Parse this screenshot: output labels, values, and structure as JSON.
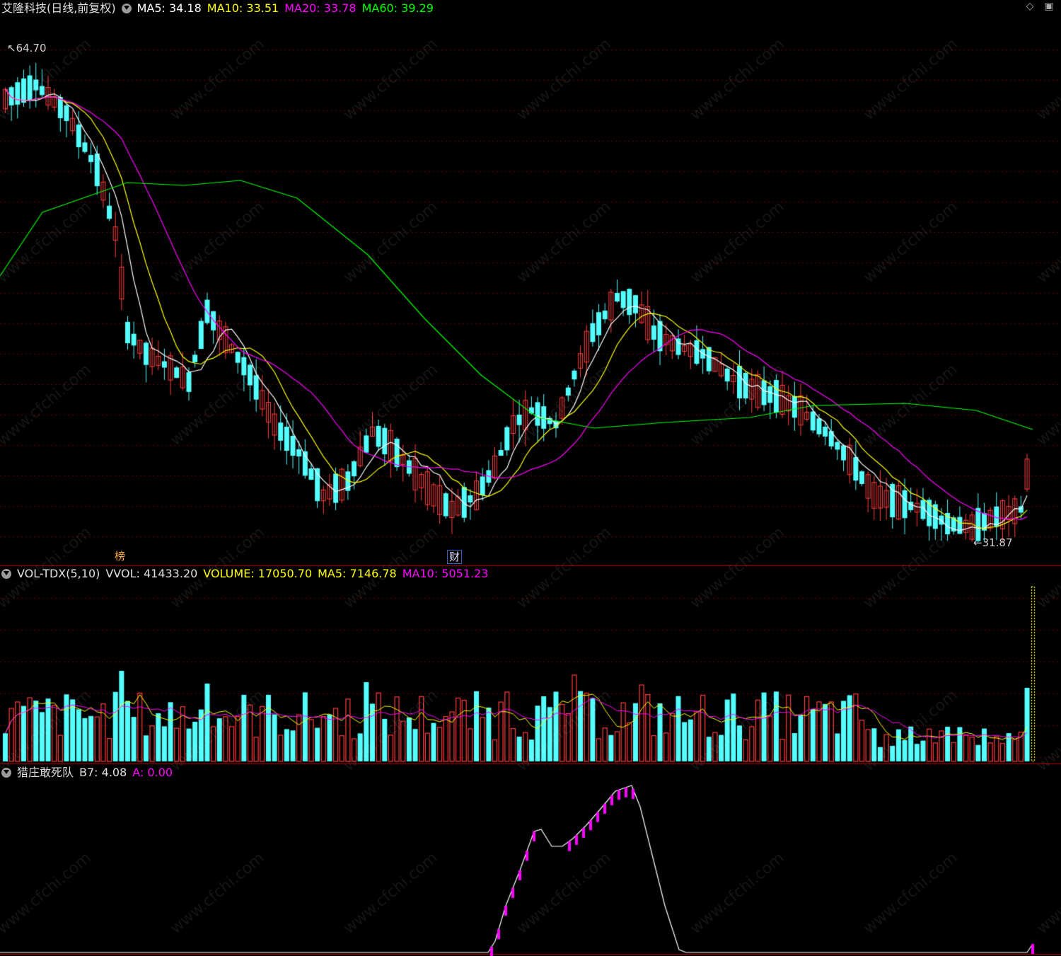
{
  "main_panel": {
    "title": "艾隆科技(日线,前复权)",
    "ma5": "MA5: 34.18",
    "ma10": "MA10: 33.51",
    "ma20": "MA20: 33.78",
    "ma60": "MA60: 39.29",
    "high_label": "64.70",
    "low_label": "31.87",
    "tag_bang": "榜",
    "tag_cai": "财",
    "colors": {
      "ma5": "#ffffff",
      "ma10": "#ffff00",
      "ma20": "#ff00ff",
      "ma60": "#00ff00",
      "up": "#ff3c3c",
      "down": "#54ffff"
    }
  },
  "volume_panel": {
    "name": "VOL-TDX(5,10)",
    "vvol": "VVOL: 41433.20",
    "volume": "VOLUME: 17050.70",
    "ma5": "MA5: 7146.78",
    "ma10": "MA10: 5051.23"
  },
  "indicator_panel": {
    "name": "猎庄敢死队",
    "b7": "B7: 4.08",
    "a": "A: 0.00"
  },
  "watermark": "www.cfchi.com",
  "icons": {
    "toggle": "diamond-icon",
    "window": "window-icon"
  }
}
